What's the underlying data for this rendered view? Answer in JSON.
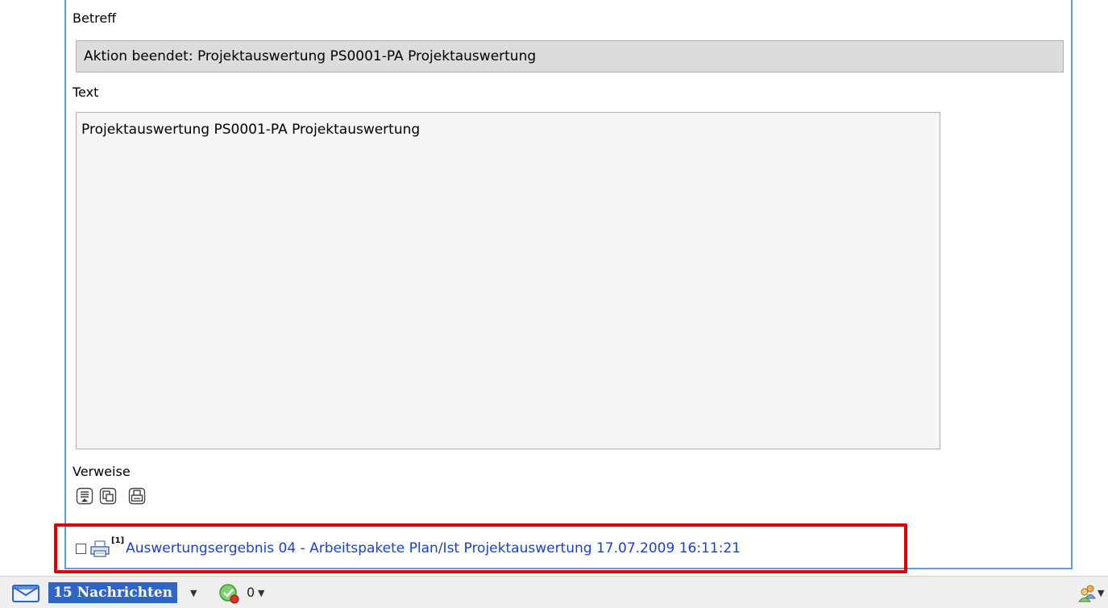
{
  "form": {
    "subject_label": "Betreff",
    "subject_value": "Aktion beendet: Projektauswertung PS0001-PA Projektauswertung",
    "text_label": "Text",
    "text_value": "Projektauswertung PS0001-PA Projektauswertung",
    "references_label": "Verweise"
  },
  "references": {
    "items": [
      {
        "badge": "[1]",
        "label": "Auswertungsergebnis 04 - Arbeitspakete Plan/Ist Projektauswertung 17.07.2009 16:11:21"
      }
    ]
  },
  "status_bar": {
    "messages_label": "15 Nachrichten",
    "todo_count": "0"
  },
  "colors": {
    "accent_blue": "#2e66c8",
    "frame_blue": "#5aa0e0",
    "link_blue": "#1a3fd6",
    "highlight_red": "#e00000"
  }
}
